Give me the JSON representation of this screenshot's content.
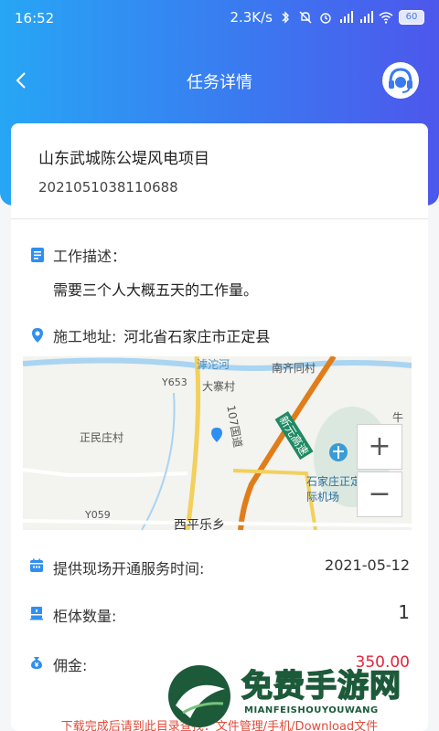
{
  "status_bar": {
    "time": "16:52",
    "network_speed": "2.3K/s",
    "battery": "60"
  },
  "header": {
    "title": "任务详情",
    "back_icon": "chevron-left-icon",
    "support_icon": "headset-icon"
  },
  "project": {
    "name": "山东武城陈公堤风电项目",
    "number": "2021051038110688"
  },
  "work_description": {
    "label": "工作描述：",
    "text": "需要三个人大概五天的工作量。"
  },
  "site_address": {
    "label": "施工地址:",
    "value": "河北省石家庄市正定县"
  },
  "map": {
    "labels": {
      "river": "滹沱河",
      "road_y653": "Y653",
      "dazhai": "大寨村",
      "nanqitong": "南齐同村",
      "xinyuan": "新元高速",
      "g107": "107国道",
      "zhengmin": "正民庄村",
      "airport": "石家庄正定国际机场",
      "road_y059": "Y059",
      "xiping": "西平乐乡",
      "niu": "牛"
    },
    "zoom_in": "+",
    "zoom_out": "−"
  },
  "details": {
    "service_time_label": "提供现场开通服务时间:",
    "service_time_value": "2021-05-12",
    "cabinet_label": "柜体数量:",
    "cabinet_value": "1",
    "commission_label": "佣金:",
    "commission_value": "350.00"
  },
  "notice": "下载完成后请到此目录查找：文件管理/手机/Download文件",
  "watermark": {
    "title": "免费手游网",
    "subtitle": "MIANFEISHOUYOUWANG"
  },
  "colors": {
    "header_start": "#27a6f5",
    "header_end": "#4d57ec",
    "accent": "#2f8ff0",
    "commission": "#e2263a",
    "notice": "#e04a3a"
  }
}
